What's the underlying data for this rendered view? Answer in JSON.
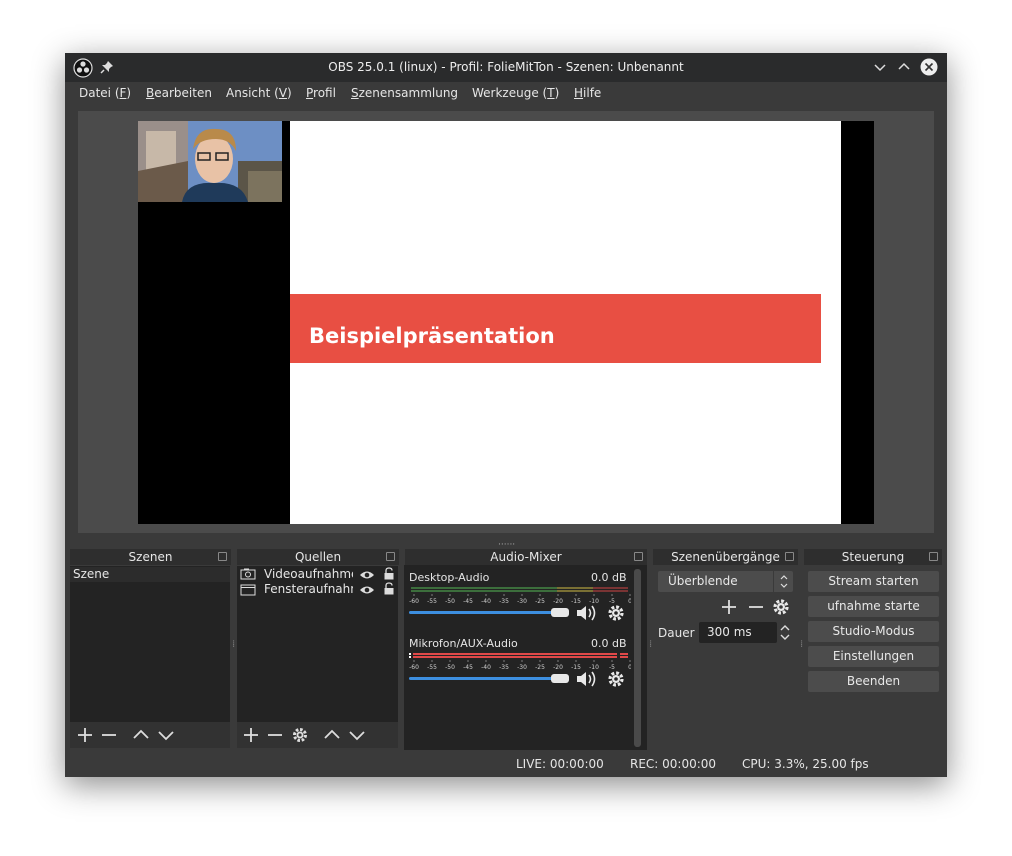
{
  "window": {
    "title": "OBS 25.0.1 (linux) - Profil: FolieMitTon - Szenen: Unbenannt"
  },
  "menu": {
    "items": [
      {
        "label": "Datei (F)",
        "mnemonic": "F",
        "pre": "Datei (",
        "post": ")"
      },
      {
        "label": "Bearbeiten",
        "mnemonic": "B",
        "pre": "",
        "post": "earbeiten"
      },
      {
        "label": "Ansicht (V)",
        "mnemonic": "V",
        "pre": "Ansicht (",
        "post": ")"
      },
      {
        "label": "Profil",
        "mnemonic": "P",
        "pre": "",
        "post": "rofil"
      },
      {
        "label": "Szenensammlung",
        "mnemonic": "S",
        "pre": "",
        "post": "zenensammlung"
      },
      {
        "label": "Werkzeuge (T)",
        "mnemonic": "T",
        "pre": "Werkzeuge (",
        "post": ")"
      },
      {
        "label": "Hilfe",
        "mnemonic": "H",
        "pre": "",
        "post": "ilfe"
      }
    ]
  },
  "preview": {
    "slide_title": "Beispielpräsentation",
    "band_color": "#e84f43"
  },
  "docks": {
    "scenes": {
      "title": "Szenen",
      "items": [
        "Szene"
      ]
    },
    "sources": {
      "title": "Quellen",
      "items": [
        {
          "label": "Videoaufnahmegerät",
          "icon": "camera-icon"
        },
        {
          "label": "Fensteraufnahme",
          "icon": "window-icon"
        }
      ]
    },
    "mixer": {
      "title": "Audio-Mixer",
      "channels": [
        {
          "name": "Desktop-Audio",
          "level": "0.0 dB",
          "volume": 1.0
        },
        {
          "name": "Mikrofon/AUX-Audio",
          "level": "0.0 dB",
          "volume": 1.0
        }
      ],
      "ticks": [
        "-60",
        "-55",
        "-50",
        "-45",
        "-40",
        "-35",
        "-30",
        "-25",
        "-20",
        "-15",
        "-10",
        "-5",
        "0"
      ]
    },
    "transitions": {
      "title": "Szenenübergänge",
      "selected": "Überblende",
      "duration_label": "Dauer",
      "duration_value": "300 ms"
    },
    "controls": {
      "title": "Steuerung",
      "buttons": [
        "Stream starten",
        "ufnahme starte",
        "Studio-Modus",
        "Einstellungen",
        "Beenden"
      ]
    }
  },
  "status": {
    "live": "LIVE: 00:00:00",
    "rec": "REC: 00:00:00",
    "cpu": "CPU: 3.3%, 25.00 fps"
  },
  "colors": {
    "accent": "#3d8fe0",
    "meter_green": "#4caf50",
    "meter_yellow": "#c9b53a",
    "meter_red": "#e04848"
  }
}
